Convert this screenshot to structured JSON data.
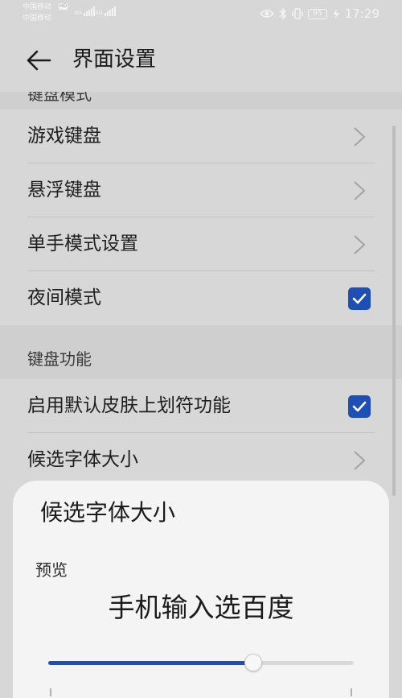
{
  "status_bar": {
    "carrier_1": "中国移动",
    "carrier_2": "中国移动",
    "hd": "HD",
    "net_1": "4G",
    "net_2": "4G",
    "battery": "95",
    "time": "17:29"
  },
  "header": {
    "title": "界面设置",
    "back_icon": "arrow-left-icon"
  },
  "list": {
    "section_top": "键盘模式",
    "items_1": [
      {
        "label": "游戏键盘",
        "control": "chevron"
      },
      {
        "label": "悬浮键盘",
        "control": "chevron"
      },
      {
        "label": "单手模式设置",
        "control": "chevron"
      },
      {
        "label": "夜间模式",
        "control": "checkbox",
        "checked": true
      }
    ],
    "section_2": "键盘功能",
    "items_2": [
      {
        "label": "启用默认皮肤上划符功能",
        "control": "checkbox",
        "checked": true
      },
      {
        "label": "候选字体大小",
        "control": "chevron"
      }
    ]
  },
  "dialog": {
    "title": "候选字体大小",
    "preview_label": "预览",
    "preview_text": "手机输入选百度",
    "slider_level": 0.67
  },
  "colors": {
    "accent": "#1d4fb5",
    "background": "#d7d7d7",
    "sheet": "#f4f4f4"
  }
}
